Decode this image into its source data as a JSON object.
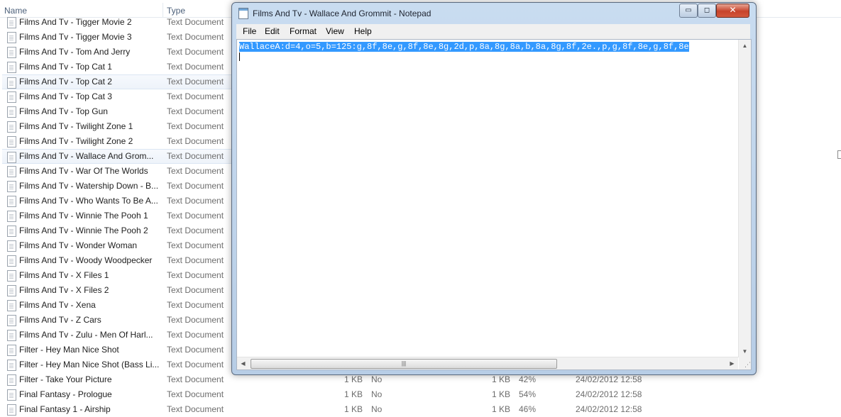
{
  "explorer": {
    "columns": {
      "name": "Name",
      "type": "Type"
    },
    "rows": [
      {
        "name": "Films And Tv - Tigger Movie 2",
        "type": "Text Document"
      },
      {
        "name": "Films And Tv - Tigger Movie 3",
        "type": "Text Document"
      },
      {
        "name": "Films And Tv - Tom And Jerry",
        "type": "Text Document"
      },
      {
        "name": "Films And Tv - Top Cat 1",
        "type": "Text Document"
      },
      {
        "name": "Films And Tv - Top Cat 2",
        "type": "Text Document"
      },
      {
        "name": "Films And Tv - Top Cat 3",
        "type": "Text Document"
      },
      {
        "name": "Films And Tv - Top Gun",
        "type": "Text Document"
      },
      {
        "name": "Films And Tv - Twilight Zone 1",
        "type": "Text Document"
      },
      {
        "name": "Films And Tv - Twilight Zone 2",
        "type": "Text Document"
      },
      {
        "name": "Films And Tv - Wallace And Grom...",
        "type": "Text Document"
      },
      {
        "name": "Films And Tv - War Of The Worlds",
        "type": "Text Document"
      },
      {
        "name": "Films And Tv - Watership Down - B...",
        "type": "Text Document"
      },
      {
        "name": "Films And Tv - Who Wants To Be A...",
        "type": "Text Document"
      },
      {
        "name": "Films And Tv - Winnie The Pooh 1",
        "type": "Text Document"
      },
      {
        "name": "Films And Tv - Winnie The Pooh 2",
        "type": "Text Document"
      },
      {
        "name": "Films And Tv - Wonder Woman",
        "type": "Text Document"
      },
      {
        "name": "Films And Tv - Woody Woodpecker",
        "type": "Text Document"
      },
      {
        "name": "Films And Tv - X Files 1",
        "type": "Text Document"
      },
      {
        "name": "Films And Tv - X Files 2",
        "type": "Text Document"
      },
      {
        "name": "Films And Tv - Xena",
        "type": "Text Document"
      },
      {
        "name": "Films And Tv - Z Cars",
        "type": "Text Document"
      },
      {
        "name": "Films And Tv - Zulu - Men Of Harl...",
        "type": "Text Document"
      },
      {
        "name": "Filter - Hey Man Nice Shot",
        "type": "Text Document"
      },
      {
        "name": "Filter - Hey Man Nice Shot (Bass Li...",
        "type": "Text Document"
      },
      {
        "name": "Filter - Take Your Picture",
        "type": "Text Document",
        "size": "1 KB",
        "flag": "No",
        "packed": "1 KB",
        "ratio": "42%",
        "date": "24/02/2012 12:58"
      },
      {
        "name": "Final Fantasy - Prologue",
        "type": "Text Document",
        "size": "1 KB",
        "flag": "No",
        "packed": "1 KB",
        "ratio": "54%",
        "date": "24/02/2012 12:58"
      },
      {
        "name": "Final Fantasy 1 - Airship",
        "type": "Text Document",
        "size": "1 KB",
        "flag": "No",
        "packed": "1 KB",
        "ratio": "46%",
        "date": "24/02/2012 12:58"
      }
    ]
  },
  "notepad": {
    "title": "Films And Tv - Wallace And Grommit - Notepad",
    "buttons": {
      "minimize": "▭",
      "maximize": "◻",
      "close": "✕"
    },
    "menu": [
      "File",
      "Edit",
      "Format",
      "View",
      "Help"
    ],
    "content": "WallaceA:d=4,o=5,b=125:g,8f,8e,g,8f,8e,8g,2d,p,8a,8g,8a,b,8a,8g,8f,2e.,p,g,8f,8e,g,8f,8e",
    "scroll_glyphs": {
      "up": "▲",
      "down": "▼",
      "left": "◀",
      "right": "▶",
      "grip": "⋰",
      "thumb": "|||"
    }
  }
}
